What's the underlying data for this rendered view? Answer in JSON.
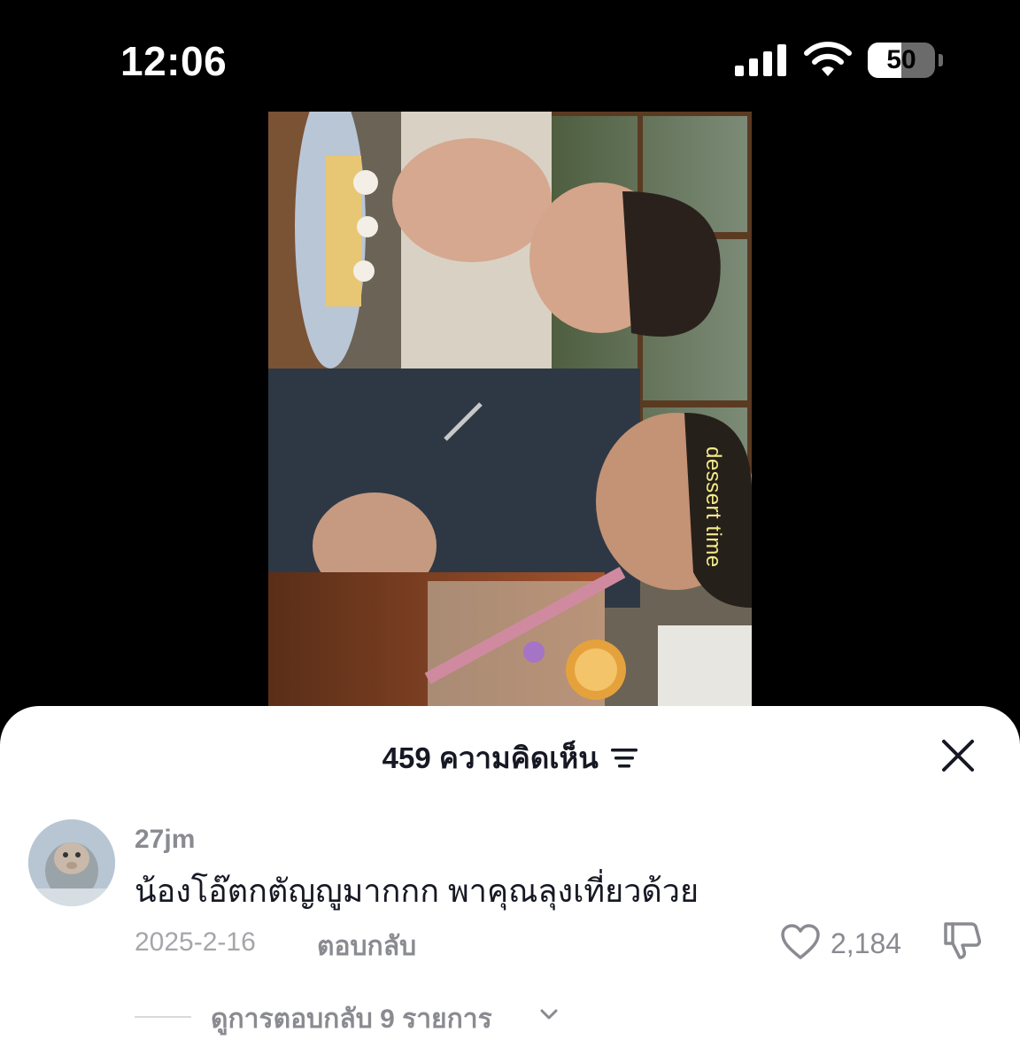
{
  "status_bar": {
    "time": "12:06",
    "battery_level": "50",
    "battery_fraction": 0.5
  },
  "video": {
    "overlay_text": "dessert time"
  },
  "comments_sheet": {
    "title": "459 ความคิดเห็น",
    "sort_icon": "sort-icon",
    "close_icon": "close-icon"
  },
  "comments": [
    {
      "username": "27jm",
      "text": "น้องโอ๊ตกตัญญูมากกก พาคุณลุงเที่ยวด้วย",
      "date": "2025-2-16",
      "reply_label": "ตอบกลับ",
      "like_count": "2,184",
      "view_replies_label": "ดูการตอบกลับ 9 รายการ"
    }
  ],
  "colors": {
    "sheet_bg": "#ffffff",
    "primary_text": "#161823",
    "secondary_text": "#8a8b91",
    "overlay_text": "#f4ea8a"
  }
}
